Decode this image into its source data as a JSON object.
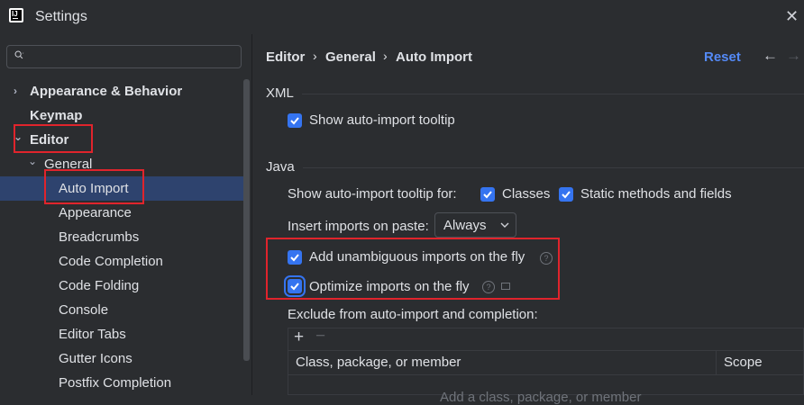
{
  "window": {
    "title": "Settings",
    "close_glyph": "✕"
  },
  "search": {
    "placeholder": "",
    "value": ""
  },
  "tree": [
    {
      "label": "Appearance & Behavior",
      "bold": true,
      "arrow": "›"
    },
    {
      "label": "Keymap",
      "bold": true,
      "arrow": ""
    },
    {
      "label": "Editor",
      "bold": true,
      "arrow": "⌄"
    },
    {
      "label": "General",
      "bold": false,
      "arrow": "⌄"
    },
    {
      "label": "Auto Import",
      "bold": false,
      "arrow": "",
      "selected": true
    },
    {
      "label": "Appearance",
      "bold": false,
      "arrow": ""
    },
    {
      "label": "Breadcrumbs",
      "bold": false,
      "arrow": ""
    },
    {
      "label": "Code Completion",
      "bold": false,
      "arrow": ""
    },
    {
      "label": "Code Folding",
      "bold": false,
      "arrow": ""
    },
    {
      "label": "Console",
      "bold": false,
      "arrow": ""
    },
    {
      "label": "Editor Tabs",
      "bold": false,
      "arrow": ""
    },
    {
      "label": "Gutter Icons",
      "bold": false,
      "arrow": ""
    },
    {
      "label": "Postfix Completion",
      "bold": false,
      "arrow": ""
    }
  ],
  "breadcrumb": {
    "items": [
      "Editor",
      "General",
      "Auto Import"
    ],
    "separator": "›"
  },
  "header": {
    "reset": "Reset",
    "back_glyph": "←",
    "forward_glyph": "→"
  },
  "xml": {
    "title": "XML",
    "show_tooltip": {
      "label": "Show auto-import tooltip",
      "checked": true
    }
  },
  "java": {
    "title": "Java",
    "show_tooltip_for": "Show auto-import tooltip for:",
    "classes": {
      "label": "Classes",
      "checked": true
    },
    "static_methods": {
      "label": "Static methods and fields",
      "checked": true
    },
    "insert_on_paste": {
      "label": "Insert imports on paste:",
      "value": "Always"
    },
    "add_unambiguous": {
      "label": "Add unambiguous imports on the fly",
      "checked": true
    },
    "optimize_imports": {
      "label": "Optimize imports on the fly",
      "checked": true
    },
    "exclude_label": "Exclude from auto-import and completion:",
    "table": {
      "add_glyph": "+",
      "remove_glyph": "−",
      "columns": [
        "Class, package, or member",
        "Scope"
      ],
      "empty_text": "Add a class, package, or member"
    }
  },
  "colors": {
    "accent": "#3574f0",
    "link": "#548af7",
    "selection": "#2e436e",
    "highlight_box": "#e0242c",
    "background": "#2b2d30"
  }
}
